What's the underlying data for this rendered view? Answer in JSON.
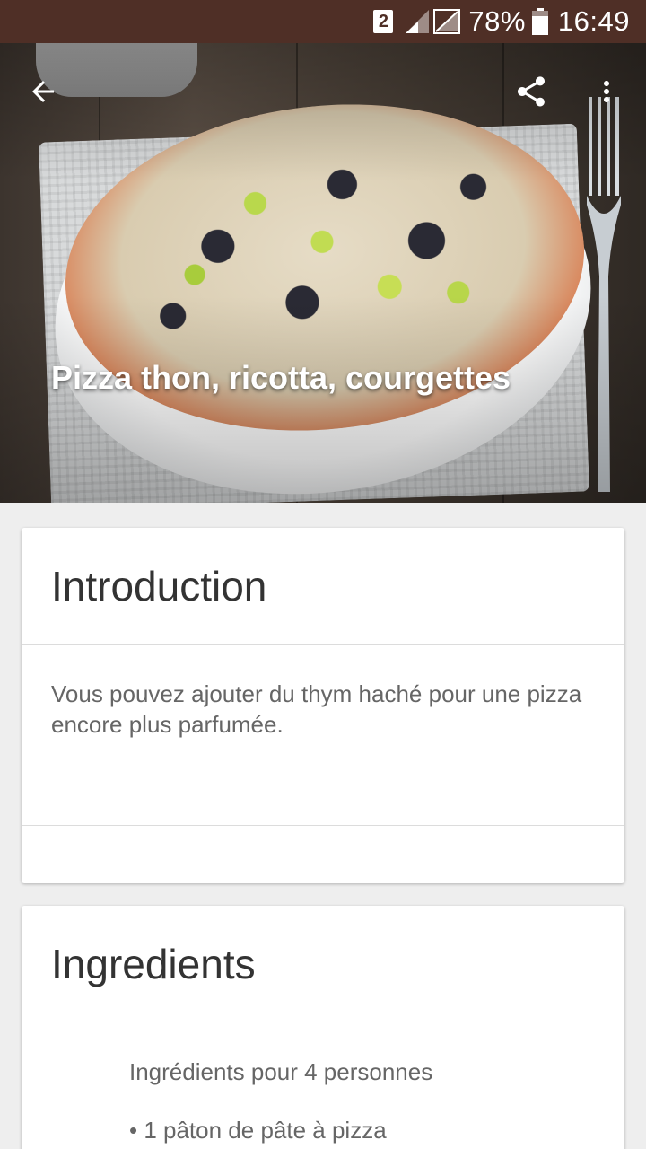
{
  "status_bar": {
    "sim": "2",
    "battery": "78%",
    "time": "16:49"
  },
  "hero": {
    "title": "Pizza thon, ricotta, courgettes",
    "icons": [
      "back-arrow-icon",
      "share-icon",
      "more-vert-icon"
    ]
  },
  "intro": {
    "title": "Introduction",
    "text": "Vous pouvez ajouter du thym haché pour une pizza encore plus parfumée."
  },
  "ingredients": {
    "title": "Ingredients",
    "subtitle": "Ingrédients pour 4 personnes",
    "items": [
      "• 1 pâton de pâte à pizza"
    ]
  },
  "colors": {
    "status_bar": "#4f2f26",
    "background": "#eeeeee",
    "card": "#ffffff"
  }
}
